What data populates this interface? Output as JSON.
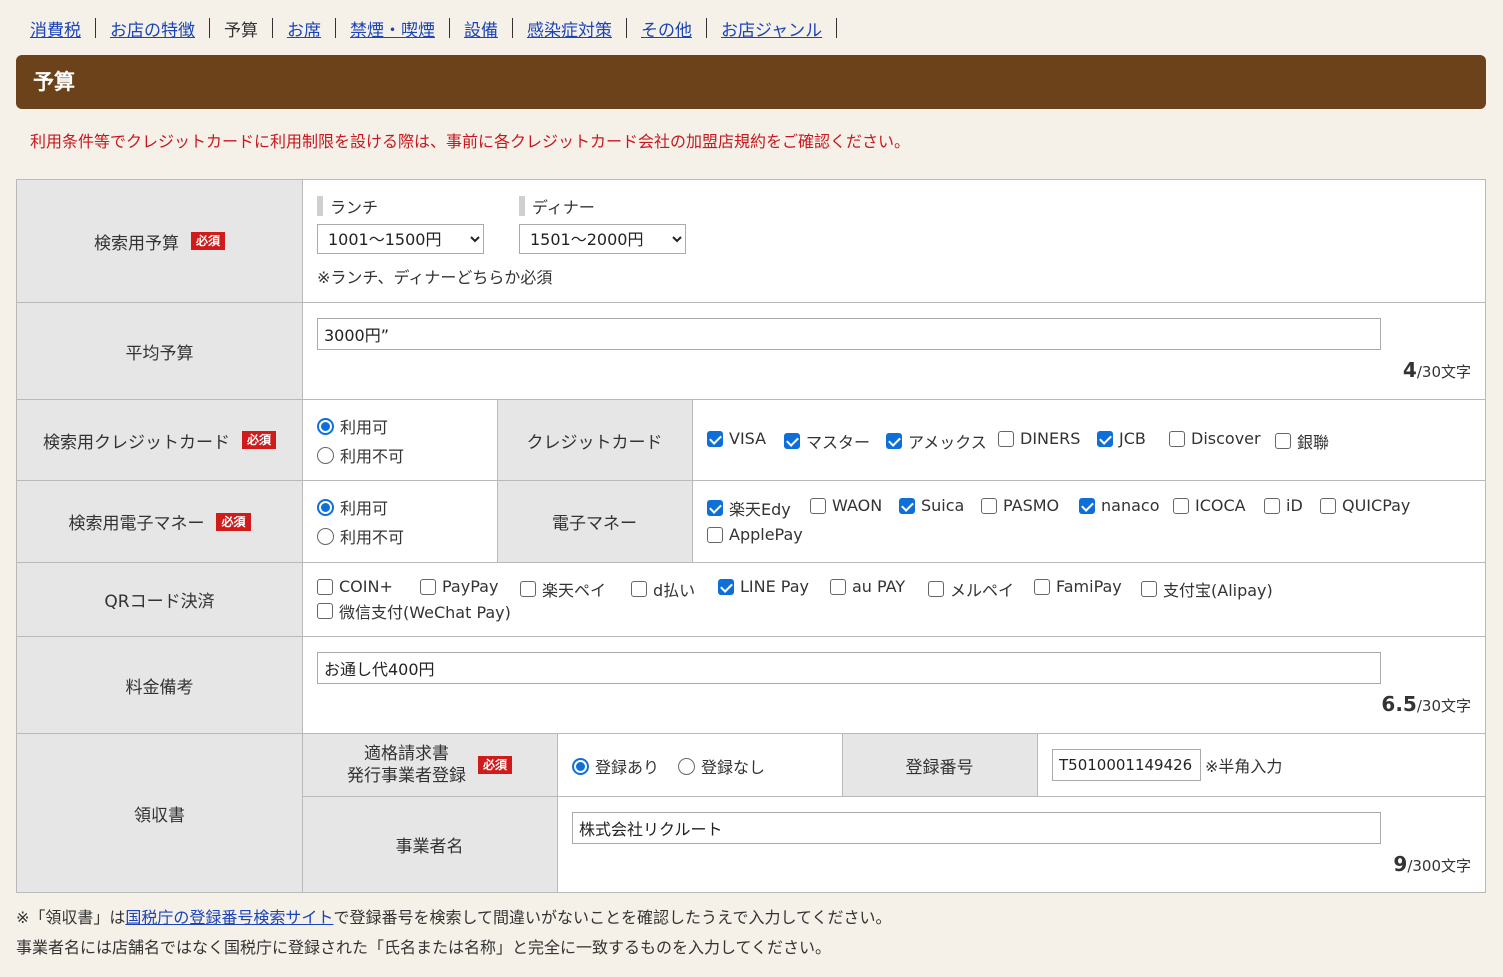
{
  "nav": {
    "items": [
      "消費税",
      "お店の特徴",
      "予算",
      "お席",
      "禁煙・喫煙",
      "設備",
      "感染症対策",
      "その他",
      "お店ジャンル"
    ],
    "current_index": 2
  },
  "section_title": "予算",
  "notice": "利用条件等でクレジットカードに利用制限を設ける際は、事前に各クレジットカード会社の加盟店規約をご確認ください。",
  "required_badge": "必須",
  "budget": {
    "label": "検索用予算",
    "lunch_label": "ランチ",
    "lunch_value": "1001～1500円",
    "dinner_label": "ディナー",
    "dinner_value": "1501～2000円",
    "note": "※ランチ、ディナーどちらか必須"
  },
  "avg_budget": {
    "label": "平均予算",
    "value": "3000円”",
    "count": "4",
    "limit": "/30文字"
  },
  "credit": {
    "label": "検索用クレジットカード",
    "radio": [
      "利用可",
      "利用不可"
    ],
    "radio_selected": 0,
    "sub_label": "クレジットカード",
    "options": [
      {
        "label": "VISA",
        "checked": true
      },
      {
        "label": "マスター",
        "checked": true
      },
      {
        "label": "アメックス",
        "checked": true
      },
      {
        "label": "DINERS",
        "checked": false
      },
      {
        "label": "JCB",
        "checked": true
      },
      {
        "label": "Discover",
        "checked": false
      },
      {
        "label": "銀聯",
        "checked": false
      }
    ]
  },
  "emoney": {
    "label": "検索用電子マネー",
    "radio": [
      "利用可",
      "利用不可"
    ],
    "radio_selected": 0,
    "sub_label": "電子マネー",
    "options": [
      {
        "label": "楽天Edy",
        "checked": true
      },
      {
        "label": "WAON",
        "checked": false
      },
      {
        "label": "Suica",
        "checked": true
      },
      {
        "label": "PASMO",
        "checked": false
      },
      {
        "label": "nanaco",
        "checked": true
      },
      {
        "label": "ICOCA",
        "checked": false
      },
      {
        "label": "iD",
        "checked": false
      },
      {
        "label": "QUICPay",
        "checked": false
      },
      {
        "label": "ApplePay",
        "checked": false
      }
    ]
  },
  "qr": {
    "label": "QRコード決済",
    "options": [
      {
        "label": "COIN+",
        "checked": false
      },
      {
        "label": "PayPay",
        "checked": false
      },
      {
        "label": "楽天ペイ",
        "checked": false
      },
      {
        "label": "d払い",
        "checked": false
      },
      {
        "label": "LINE Pay",
        "checked": true
      },
      {
        "label": "au PAY",
        "checked": false
      },
      {
        "label": "メルペイ",
        "checked": false
      },
      {
        "label": "FamiPay",
        "checked": false
      },
      {
        "label": "支付宝(Alipay)",
        "checked": false
      },
      {
        "label": "微信支付(WeChat Pay)",
        "checked": false
      }
    ]
  },
  "fee_note": {
    "label": "料金備考",
    "value": "お通し代400円",
    "count": "6.5",
    "limit": "/30文字"
  },
  "receipt": {
    "label": "領収書",
    "invoice_label_1": "適格請求書",
    "invoice_label_2": "発行事業者登録",
    "radio": [
      "登録あり",
      "登録なし"
    ],
    "radio_selected": 0,
    "reg_no_label": "登録番号",
    "reg_no_value": "T5010001149426",
    "reg_no_hint": "※半角入力",
    "business_label": "事業者名",
    "business_value": "株式会社リクルート",
    "count": "9",
    "limit": "/300文字"
  },
  "footer": {
    "line1_pre": "※「領収書」は",
    "line1_link": "国税庁の登録番号検索サイト",
    "line1_post": "で登録番号を検索して間違いがないことを確認したうえで入力してください。",
    "line2": "事業者名には店舗名ではなく国税庁に登録された「氏名または名称」と完全に一致するものを入力してください。"
  }
}
